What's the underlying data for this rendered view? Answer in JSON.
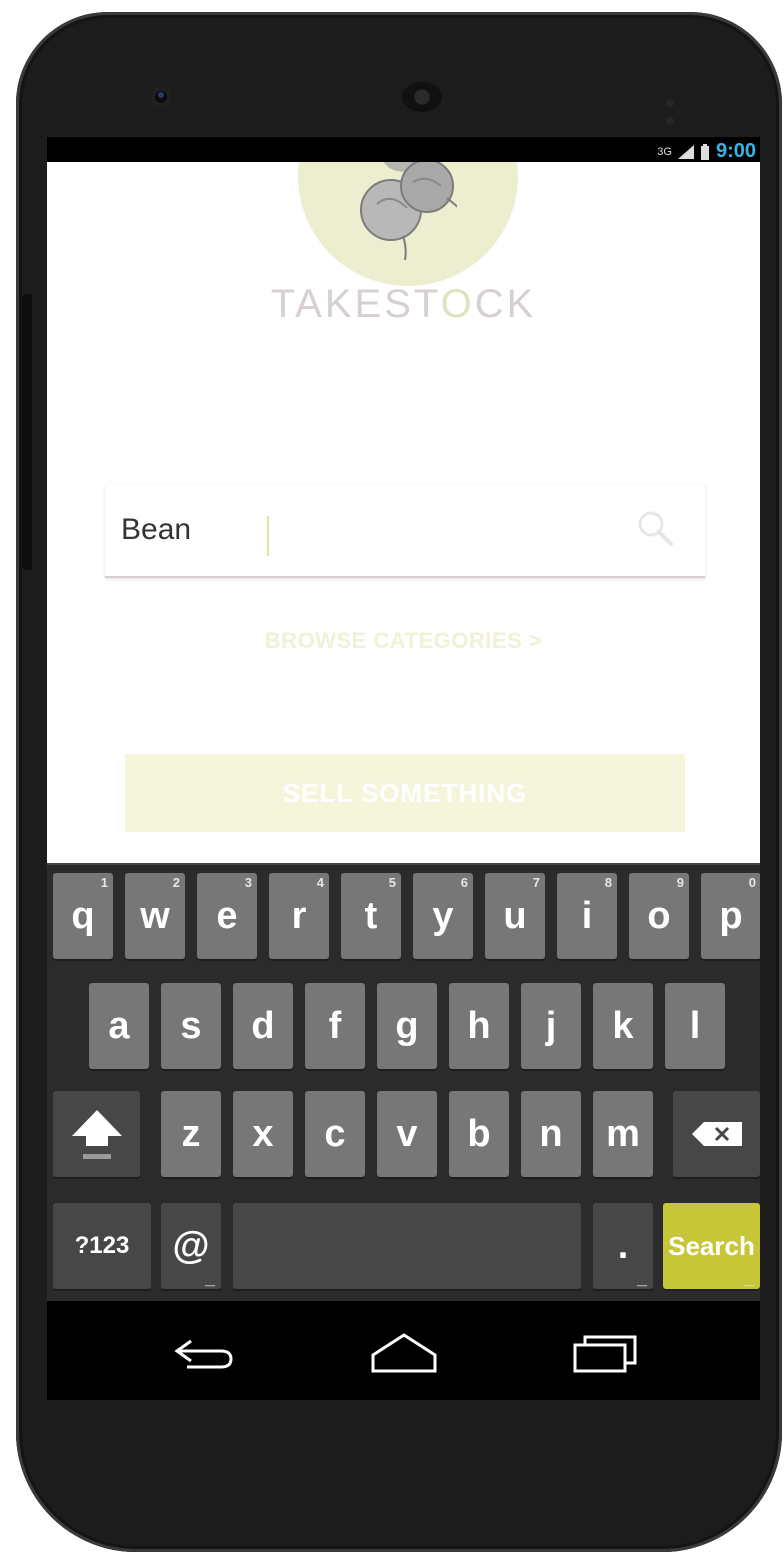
{
  "status": {
    "network": "3G",
    "time": "9:00"
  },
  "app": {
    "brand_prefix": "TAKEST",
    "brand_o": "O",
    "brand_suffix": "CK",
    "search": {
      "value": "Bean"
    },
    "browse_label": "BROWSE CATEGORIES >",
    "sell_label": "SELL SOMETHING"
  },
  "keyboard": {
    "row1": [
      {
        "label": "q",
        "hint": "1"
      },
      {
        "label": "w",
        "hint": "2"
      },
      {
        "label": "e",
        "hint": "3"
      },
      {
        "label": "r",
        "hint": "4"
      },
      {
        "label": "t",
        "hint": "5"
      },
      {
        "label": "y",
        "hint": "6"
      },
      {
        "label": "u",
        "hint": "7"
      },
      {
        "label": "i",
        "hint": "8"
      },
      {
        "label": "o",
        "hint": "9"
      },
      {
        "label": "p",
        "hint": "0"
      }
    ],
    "row2": [
      "a",
      "s",
      "d",
      "f",
      "g",
      "h",
      "j",
      "k",
      "l"
    ],
    "row3": [
      "z",
      "x",
      "c",
      "v",
      "b",
      "n",
      "m"
    ],
    "symbols_label": "?123",
    "at_label": "@",
    "period_label": ".",
    "search_label": "Search"
  },
  "icons": {
    "search": "magnifier-icon",
    "shift": "shift-arrow-icon",
    "backspace": "backspace-icon",
    "back": "back-arrow-icon",
    "home": "home-icon",
    "recents": "recent-apps-icon"
  },
  "colors": {
    "accent": "#c6c638",
    "brand_text": "#d7cfd2",
    "time": "#33b5e5",
    "key": "#777777",
    "key_dark": "#474747"
  }
}
